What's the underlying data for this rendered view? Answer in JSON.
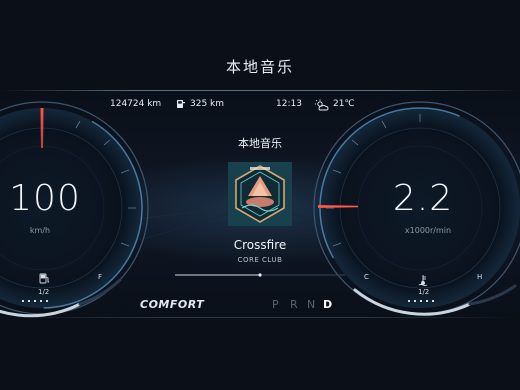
{
  "page_title": "本地音乐",
  "status": {
    "odometer": "124724 km",
    "range": "325 km",
    "time": "12:13",
    "temperature": "21℃"
  },
  "speed_gauge": {
    "value": "100",
    "unit": "km/h",
    "fuel_fraction_label": "1/2",
    "fuel_full_label": "F",
    "needle_color": "#ff4a3a"
  },
  "rpm_gauge": {
    "value": "2.2",
    "unit": "x1000r/min",
    "cold_label": "C",
    "hot_label": "H",
    "temp_fraction_label": "1/2",
    "needle_color": "#ff4a3a"
  },
  "media": {
    "source_title": "本地音乐",
    "song": "Crossfire",
    "artist": "CORE CLUB",
    "progress": 0.5
  },
  "drive_mode": "COMFORT",
  "gears": [
    "P",
    "R",
    "N",
    "D"
  ],
  "active_gear": "D",
  "colors": {
    "accent_blue": "#6fc3ff",
    "warning_red": "#ff4a3a",
    "arc_light": "#c9d4df"
  }
}
